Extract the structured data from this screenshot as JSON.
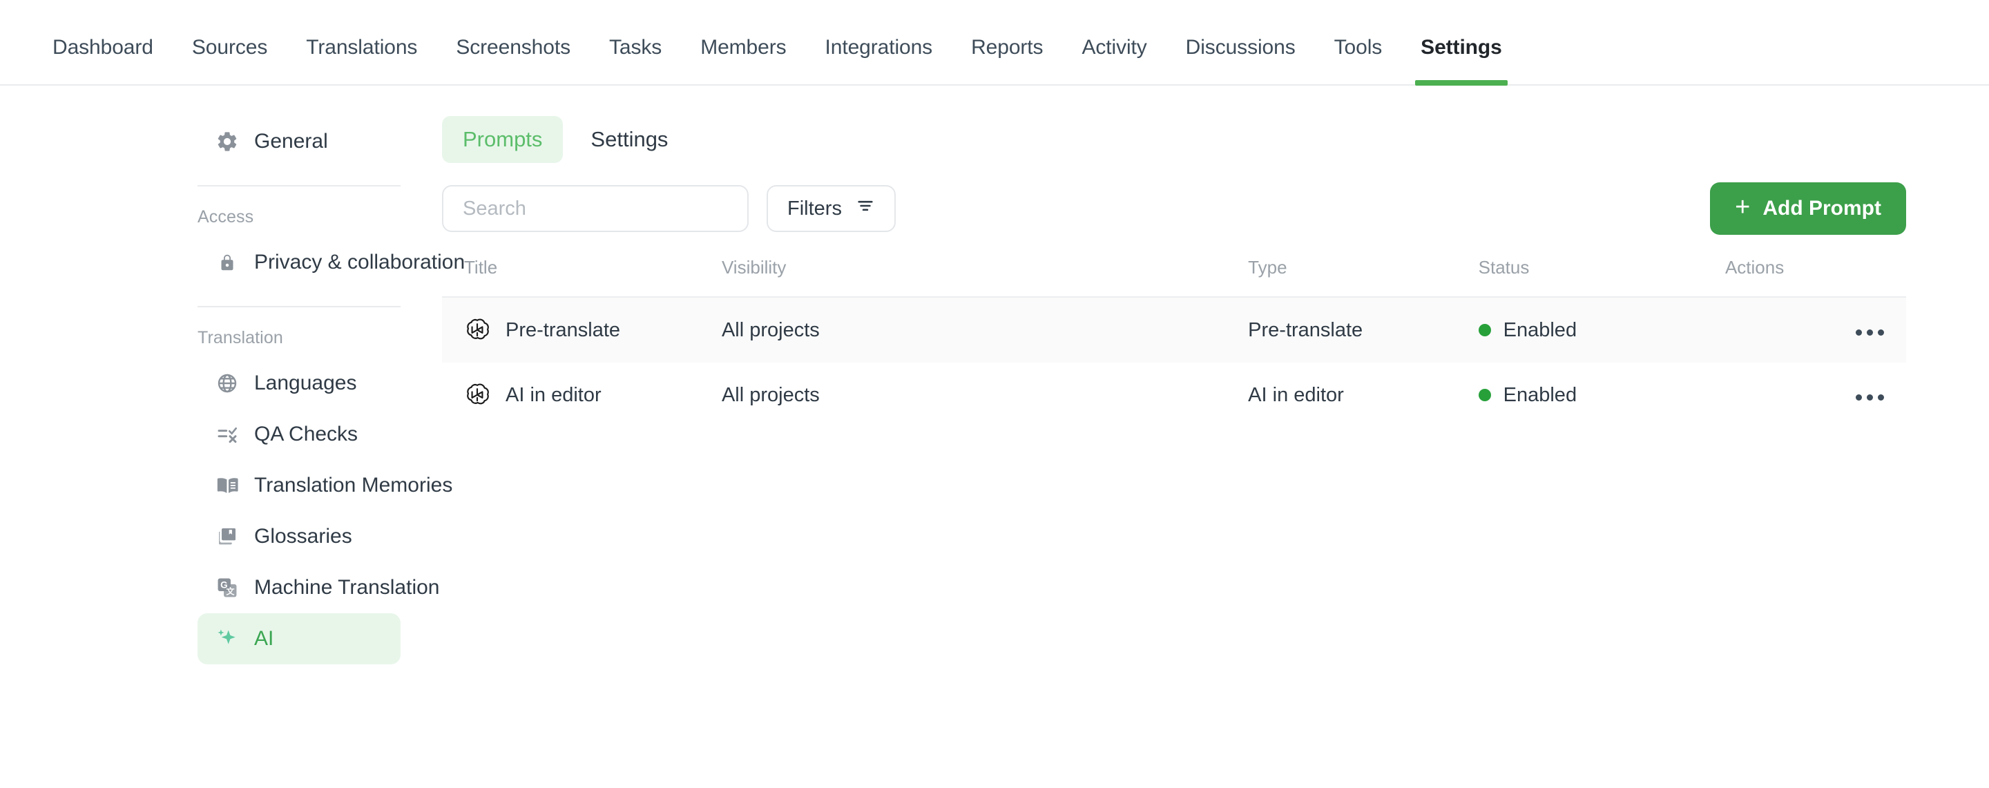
{
  "topnav": {
    "items": [
      {
        "label": "Dashboard",
        "active": false
      },
      {
        "label": "Sources",
        "active": false
      },
      {
        "label": "Translations",
        "active": false
      },
      {
        "label": "Screenshots",
        "active": false
      },
      {
        "label": "Tasks",
        "active": false
      },
      {
        "label": "Members",
        "active": false
      },
      {
        "label": "Integrations",
        "active": false
      },
      {
        "label": "Reports",
        "active": false
      },
      {
        "label": "Activity",
        "active": false
      },
      {
        "label": "Discussions",
        "active": false
      },
      {
        "label": "Tools",
        "active": false
      },
      {
        "label": "Settings",
        "active": true
      }
    ]
  },
  "sidebar": {
    "general": {
      "label": "General",
      "icon": "gear-icon"
    },
    "groups": [
      {
        "label": "Access",
        "items": [
          {
            "label": "Privacy & collaboration",
            "icon": "lock-icon",
            "selected": false
          }
        ]
      },
      {
        "label": "Translation",
        "items": [
          {
            "label": "Languages",
            "icon": "globe-icon",
            "selected": false
          },
          {
            "label": "QA Checks",
            "icon": "qa-checks-icon",
            "selected": false
          },
          {
            "label": "Translation Memories",
            "icon": "open-book-icon",
            "selected": false
          },
          {
            "label": "Glossaries",
            "icon": "bookmark-book-icon",
            "selected": false
          },
          {
            "label": "Machine Translation",
            "icon": "machine-translation-icon",
            "selected": false
          },
          {
            "label": "AI",
            "icon": "sparkle-icon",
            "selected": true
          }
        ]
      }
    ]
  },
  "main": {
    "tabs": [
      {
        "label": "Prompts",
        "active": true
      },
      {
        "label": "Settings",
        "active": false
      }
    ],
    "search": {
      "value": "",
      "placeholder": "Search"
    },
    "filters_label": "Filters",
    "add_prompt_label": "Add Prompt",
    "add_prompt_plus": "+",
    "table": {
      "headers": [
        "Title",
        "Visibility",
        "Type",
        "Status",
        "Actions"
      ],
      "rows": [
        {
          "icon": "openai-logo-icon",
          "title": "Pre-translate",
          "visibility": "All projects",
          "type": "Pre-translate",
          "status": "Enabled",
          "hovered": true
        },
        {
          "icon": "openai-logo-icon",
          "title": "AI in editor",
          "visibility": "All projects",
          "type": "AI in editor",
          "status": "Enabled",
          "hovered": false
        }
      ]
    }
  },
  "colors": {
    "accent_green": "#3c9f4a",
    "active_tab_green": "#4caf50",
    "soft_green_bg": "#e8f6ea",
    "status_dot": "#27a03a",
    "text": "#2f3a45",
    "muted": "#9aa1a8"
  }
}
